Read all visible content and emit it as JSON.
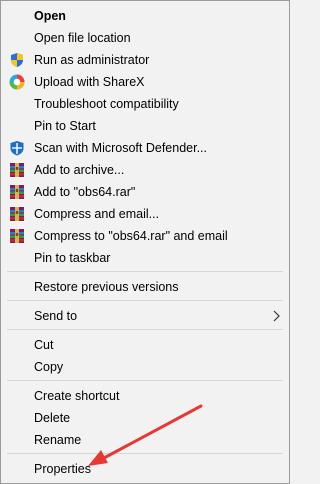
{
  "colors": {
    "menu_bg": "#f2f2f2",
    "separator": "#d6d6d6",
    "annotation_arrow": "#e53935"
  },
  "menu": {
    "items": [
      {
        "label": "Open",
        "icon": null,
        "bold": true
      },
      {
        "label": "Open file location",
        "icon": null
      },
      {
        "label": "Run as administrator",
        "icon": "uac-shield-icon"
      },
      {
        "label": "Upload with ShareX",
        "icon": "sharex-icon"
      },
      {
        "label": "Troubleshoot compatibility",
        "icon": null
      },
      {
        "label": "Pin to Start",
        "icon": null
      },
      {
        "label": "Scan with Microsoft Defender...",
        "icon": "defender-icon"
      },
      {
        "label": "Add to archive...",
        "icon": "winrar-icon"
      },
      {
        "label": "Add to \"obs64.rar\"",
        "icon": "winrar-icon"
      },
      {
        "label": "Compress and email...",
        "icon": "winrar-icon"
      },
      {
        "label": "Compress to \"obs64.rar\" and email",
        "icon": "winrar-icon"
      },
      {
        "label": "Pin to taskbar",
        "icon": null
      },
      {
        "label": "Restore previous versions",
        "icon": null
      },
      {
        "label": "Send to",
        "icon": null,
        "submenu": true
      },
      {
        "label": "Cut",
        "icon": null
      },
      {
        "label": "Copy",
        "icon": null
      },
      {
        "label": "Create shortcut",
        "icon": null
      },
      {
        "label": "Delete",
        "icon": null
      },
      {
        "label": "Rename",
        "icon": null
      },
      {
        "label": "Properties",
        "icon": null
      }
    ]
  }
}
